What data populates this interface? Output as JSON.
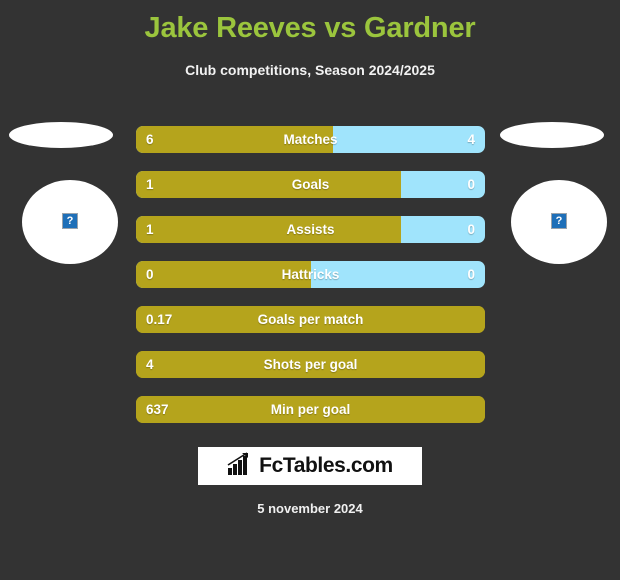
{
  "header": {
    "title": "Jake Reeves vs Gardner",
    "subtitle": "Club competitions, Season 2024/2025",
    "title_color": "#9BC53D",
    "background_color": "#333333"
  },
  "players": {
    "left": {
      "flag_placeholder": "broken-image",
      "crest_placeholder": "?"
    },
    "right": {
      "flag_placeholder": "broken-image",
      "crest_placeholder": "?"
    }
  },
  "colors": {
    "home_bar": "#B5A41C",
    "away_bar": "#A0E4FC",
    "label_text": "#FFFFFF"
  },
  "chart_data": {
    "type": "bar",
    "title": "Jake Reeves vs Gardner",
    "subtitle": "Club competitions, Season 2024/2025",
    "orientation": "horizontal-diverging",
    "categories": [
      "Matches",
      "Goals",
      "Assists",
      "Hattricks",
      "Goals per match",
      "Shots per goal",
      "Min per goal"
    ],
    "series": [
      {
        "name": "Jake Reeves",
        "values": [
          6,
          1,
          1,
          0,
          0.17,
          4,
          637
        ]
      },
      {
        "name": "Gardner",
        "values": [
          4,
          0,
          0,
          0,
          null,
          null,
          null
        ]
      }
    ],
    "legend_position": "none",
    "grid": false
  },
  "stats": [
    {
      "label": "Matches",
      "left_value": "6",
      "right_value": "4",
      "fill_percent": 56.5,
      "split": true
    },
    {
      "label": "Goals",
      "left_value": "1",
      "right_value": "0",
      "fill_percent": 75.9,
      "split": true
    },
    {
      "label": "Assists",
      "left_value": "1",
      "right_value": "0",
      "fill_percent": 75.9,
      "split": true
    },
    {
      "label": "Hattricks",
      "left_value": "0",
      "right_value": "0",
      "fill_percent": 50.0,
      "split": true
    },
    {
      "label": "Goals per match",
      "left_value": "0.17",
      "right_value": "",
      "fill_percent": 100,
      "split": false
    },
    {
      "label": "Shots per goal",
      "left_value": "4",
      "right_value": "",
      "fill_percent": 100,
      "split": false
    },
    {
      "label": "Min per goal",
      "left_value": "637",
      "right_value": "",
      "fill_percent": 100,
      "split": false
    }
  ],
  "logo": {
    "text": "FcTables.com",
    "icon": "bar-chart-arrow-icon"
  },
  "footer": {
    "date": "5 november 2024"
  }
}
